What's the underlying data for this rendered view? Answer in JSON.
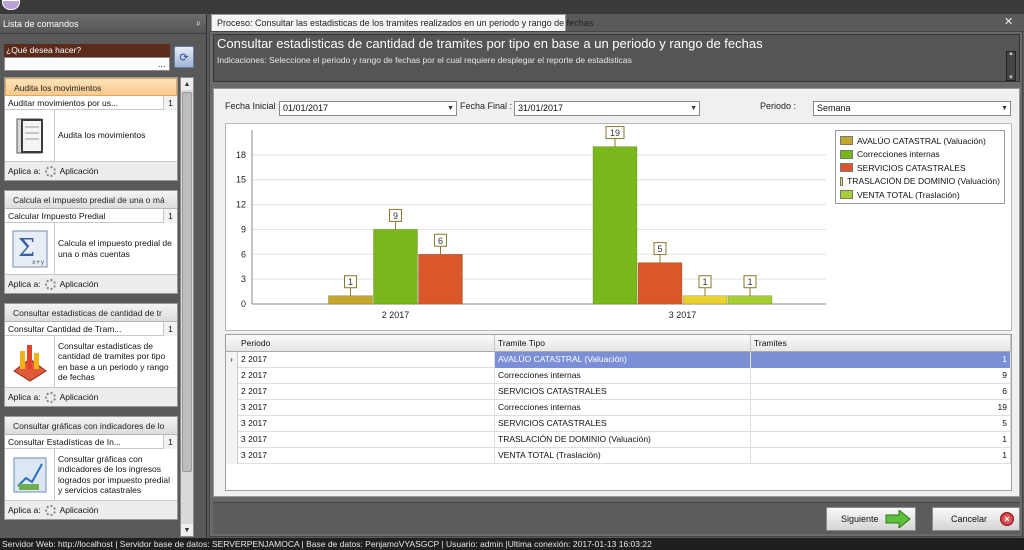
{
  "left_panel": {
    "title": "Lista de comandos",
    "pin_icon": "pin-icon",
    "search_label": "¿Qué desea hacer?",
    "search_value": "",
    "search_dots": "...",
    "cards": [
      {
        "header": "Audita los movimientos",
        "command": "Auditar movimientos por us...",
        "count": "1",
        "description": "Audita los movimientos",
        "apply_label": "Aplica a:",
        "apply_value": "Aplicación",
        "icon": "audit-book-icon",
        "active": true
      },
      {
        "header": "Calcula el impuesto predial de una o má",
        "command": "Calcular Impuesto Predial",
        "count": "1",
        "description": "Calcula el impuesto predial de una o más cuentas",
        "apply_label": "Aplica a:",
        "apply_value": "Aplicación",
        "icon": "sigma-formula-icon",
        "active": false
      },
      {
        "header": "Consultar estadisticas de cantidad de tr",
        "command": "Consultar Cantidad de Tram...",
        "count": "1",
        "description": "Consultar estadisticas de cantidad de tramites por tipo en base a un periodo y rango de fechas",
        "apply_label": "Aplica a:",
        "apply_value": "Aplicación",
        "icon": "statistics-chart-icon",
        "active": false
      },
      {
        "header": "Consultar gráficas con indicadores de lo",
        "command": "Consultar Estadísticas de In...",
        "count": "1",
        "description": "Consultar gráficas con indicadores de los ingresos logrados por impuesto predial y servicios catastrales",
        "apply_label": "Aplica a:",
        "apply_value": "Aplicación",
        "icon": "income-graph-icon",
        "active": false
      }
    ]
  },
  "tab": {
    "label": "Proceso: Consultar las estadisticas de los tramites realizados en un periodo y rango de fechas",
    "close": "✕"
  },
  "header": {
    "title": "Consultar estadisticas de cantidad de tramites por tipo en base a un periodo y rango de fechas",
    "indications": "Indicaciones: Seleccione el periodo y rango de fechas por el cual requiere desplegar el reporte de estadisticas"
  },
  "filters": {
    "fecha_inicial_label": "Fecha Inicial :",
    "fecha_inicial_value": "01/01/2017",
    "fecha_final_label": "Fecha Final :",
    "fecha_final_value": "31/01/2017",
    "periodo_label": "Periodo :",
    "periodo_value": "Semana"
  },
  "chart_data": {
    "type": "bar",
    "categories": [
      "2 2017",
      "3 2017"
    ],
    "ylim": [
      0,
      21
    ],
    "yticks": [
      0,
      3,
      6,
      9,
      12,
      15,
      18
    ],
    "legend_position": "top-right",
    "series": [
      {
        "name": "AVALÚO CATASTRAL (Valuación)",
        "color": "#c4a72e",
        "values": [
          1,
          null
        ]
      },
      {
        "name": "Correcciones internas",
        "color": "#78b81a",
        "values": [
          9,
          19
        ]
      },
      {
        "name": "SERVICIOS CATASTRALES",
        "color": "#d9572a",
        "values": [
          6,
          5
        ]
      },
      {
        "name": "TRASLACIÓN DE DOMINIO (Valuación)",
        "color": "#e8d230",
        "values": [
          null,
          1
        ]
      },
      {
        "name": "VENTA TOTAL (Traslación)",
        "color": "#a6cf34",
        "values": [
          null,
          1
        ]
      }
    ]
  },
  "grid": {
    "headers": [
      "Periodo",
      "Tramite Tipo",
      "Tramites"
    ],
    "rows": [
      {
        "periodo": "2 2017",
        "tipo": "AVALÚO CATASTRAL (Valuación)",
        "tramites": "1",
        "selected": true
      },
      {
        "periodo": "2 2017",
        "tipo": "Correcciones internas",
        "tramites": "9"
      },
      {
        "periodo": "2 2017",
        "tipo": "SERVICIOS CATASTRALES",
        "tramites": "6"
      },
      {
        "periodo": "3 2017",
        "tipo": "Correcciones internas",
        "tramites": "19"
      },
      {
        "periodo": "3 2017",
        "tipo": "SERVICIOS CATASTRALES",
        "tramites": "5"
      },
      {
        "periodo": "3 2017",
        "tipo": "TRASLACIÓN DE DOMINIO (Valuación)",
        "tramites": "1"
      },
      {
        "periodo": "3 2017",
        "tipo": "VENTA TOTAL (Traslación)",
        "tramites": "1"
      }
    ],
    "selected_indicator": "›"
  },
  "buttons": {
    "next_label": "Siguiente",
    "cancel_label": "Cancelar"
  },
  "status_bar": "Servidor Web:  http://localhost  | Servidor base de datos:  SERVERPENJAMOCA  | Base de datos:  PenjamoVYASGCP  | Usuario:  admin  |Ultima conexión:  2017-01-13 16:03:22"
}
